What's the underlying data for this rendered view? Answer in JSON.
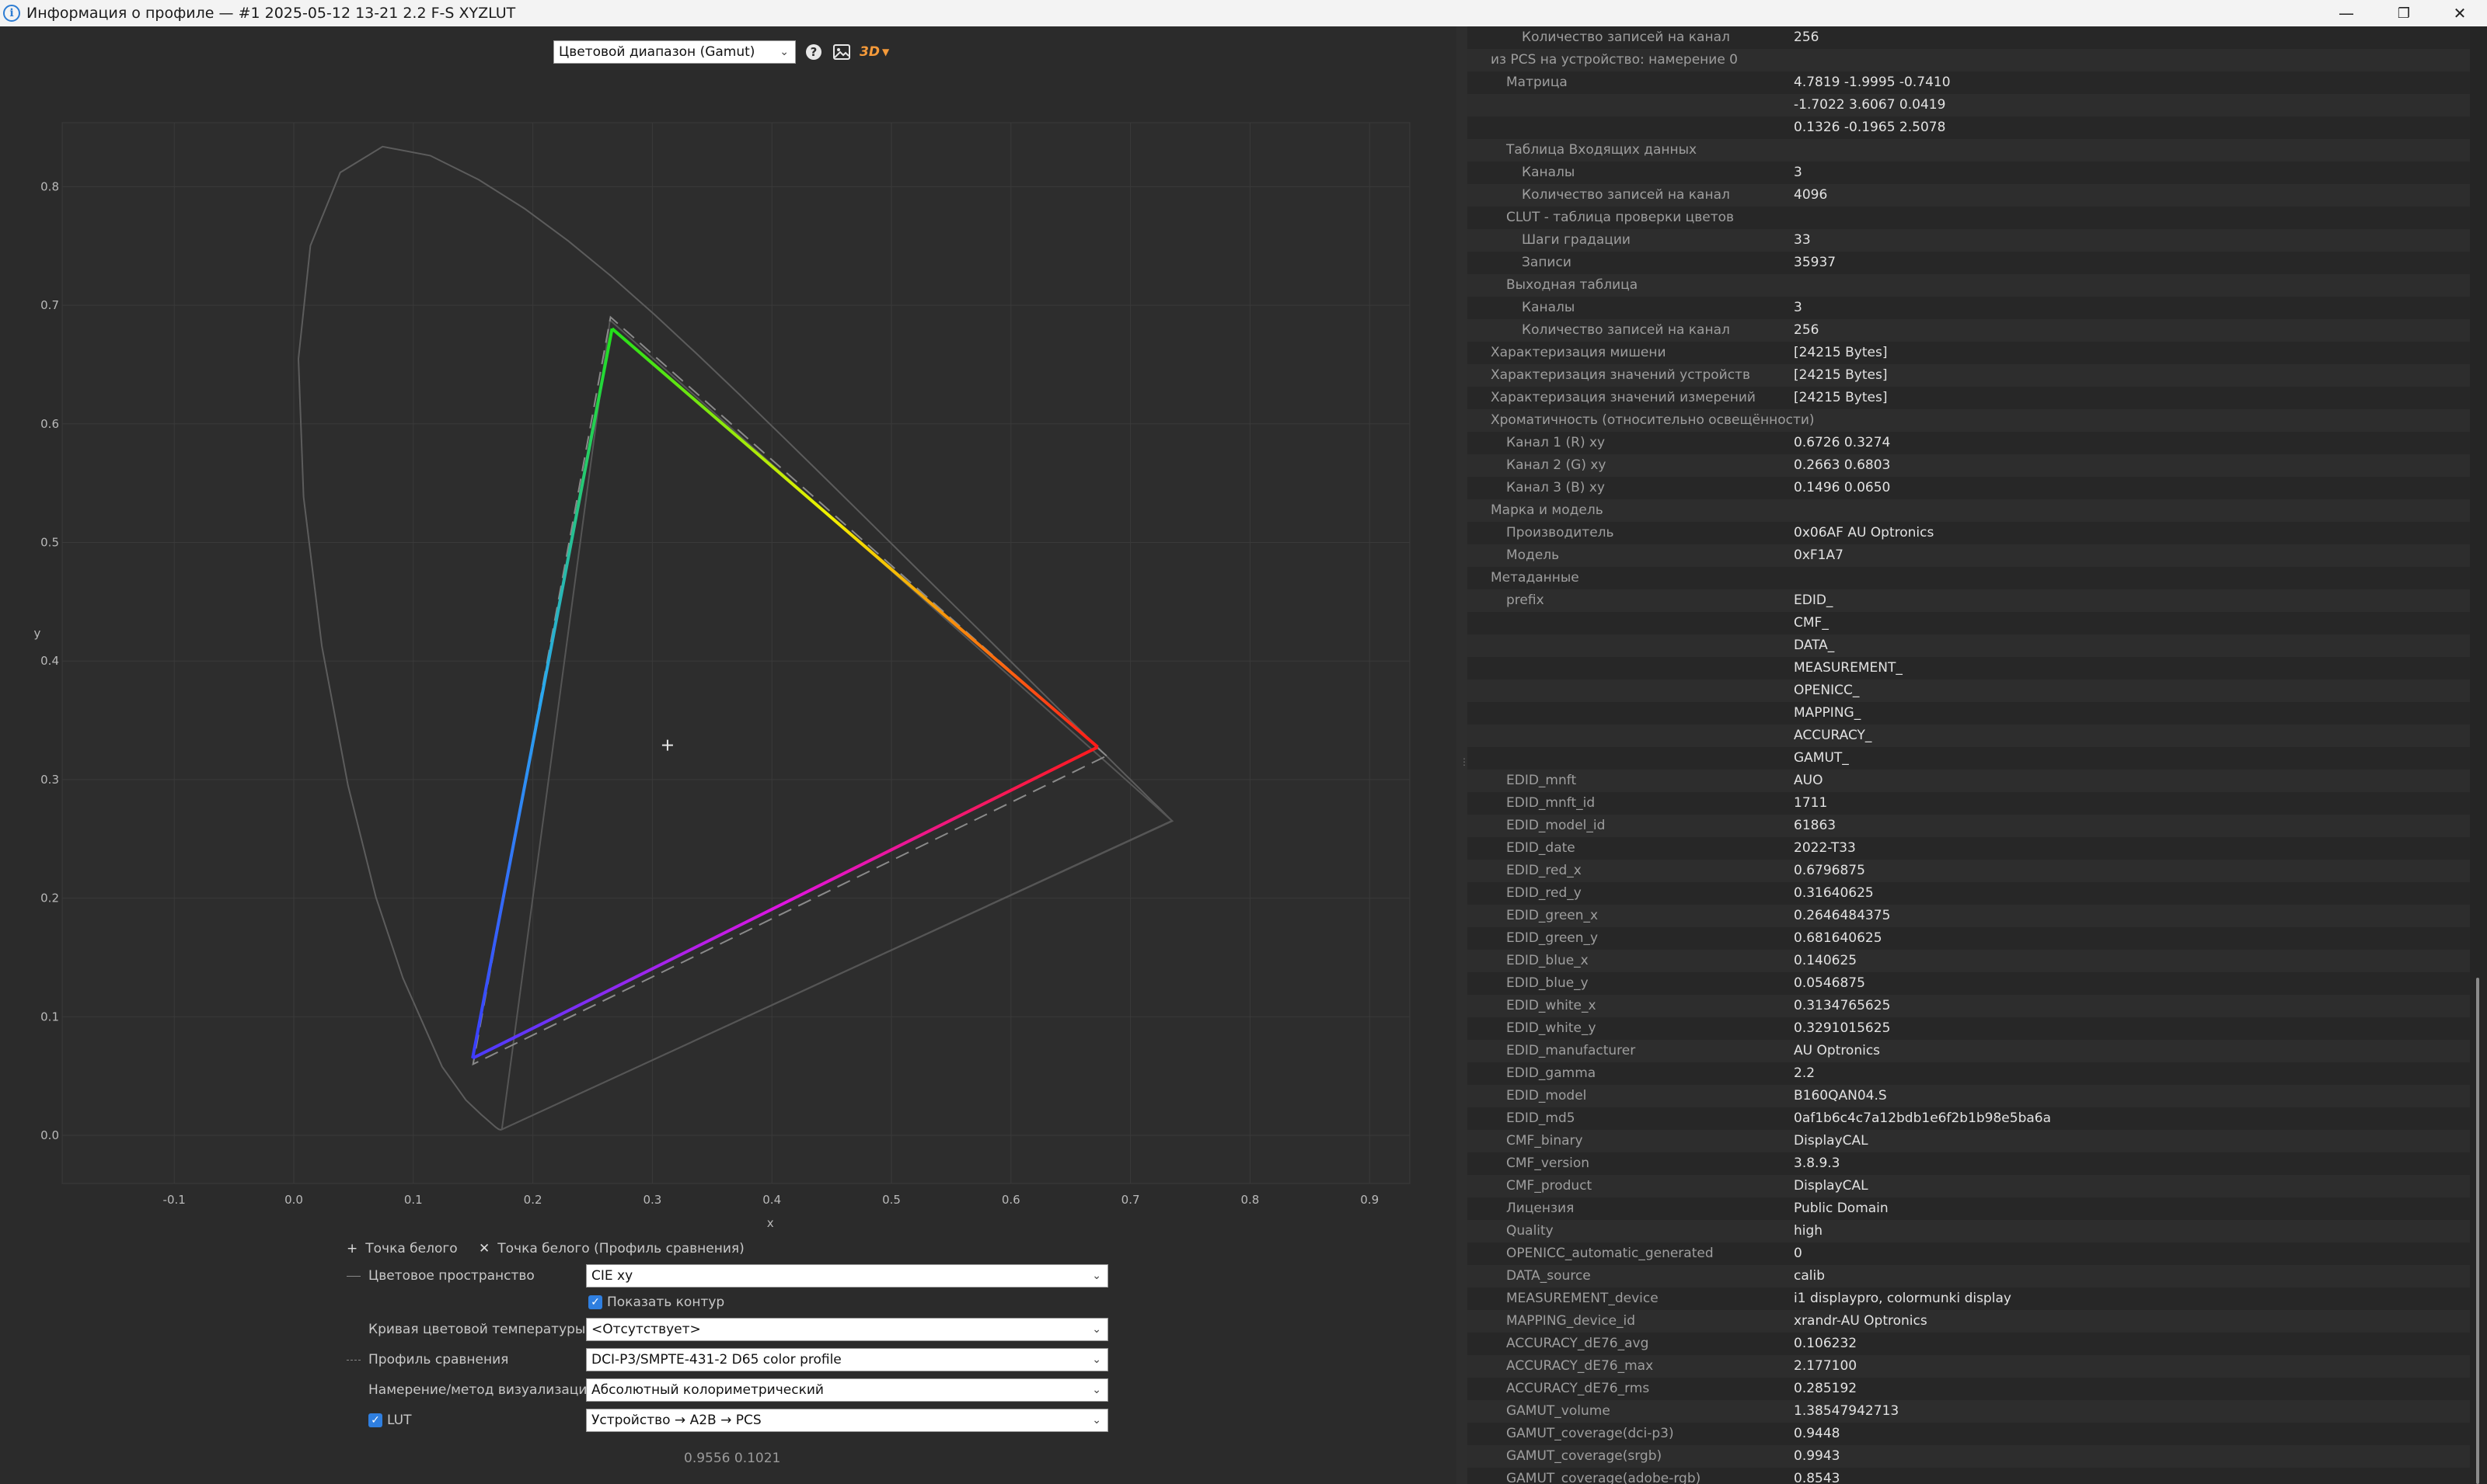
{
  "window": {
    "title": "Информация о профиле — #1 2025-05-12 13-21 2.2 F-S XYZLUT",
    "controls": {
      "minimize": "—",
      "maximize": "❐",
      "close": "✕"
    }
  },
  "toolbar": {
    "view_select": "Цветовой диапазон (Gamut)",
    "help_icon": "?",
    "image_icon": "▣",
    "view3d_label": "3D"
  },
  "plot": {
    "x_ticks": [
      "-0.1",
      "0.0",
      "0.1",
      "0.2",
      "0.3",
      "0.4",
      "0.5",
      "0.6",
      "0.7",
      "0.8",
      "0.9"
    ],
    "y_ticks": [
      "0.0",
      "0.1",
      "0.2",
      "0.3",
      "0.4",
      "0.5",
      "0.6",
      "0.7",
      "0.8"
    ],
    "xlabel": "x",
    "ylabel": "y",
    "gamut_primaries": {
      "red": [
        0.6726,
        0.3274
      ],
      "green": [
        0.2663,
        0.6803
      ],
      "blue": [
        0.1496,
        0.065
      ]
    },
    "reference_primaries": {
      "red": [
        0.68,
        0.32
      ],
      "green": [
        0.265,
        0.69
      ],
      "blue": [
        0.15,
        0.06
      ]
    },
    "outer_triangle": [
      [
        0.735,
        0.265
      ],
      [
        0.1741,
        0.005
      ],
      [
        0.2645,
        0.6875
      ]
    ],
    "cursor_readout": "0.9556 0.1021"
  },
  "controls": {
    "white_point": "Точка белого",
    "white_point_ref": "Точка белого (Профиль сравнения)",
    "color_space_label": "Цветовое пространство",
    "color_space_value": "CIE xy",
    "show_outline": "Показать контур",
    "cct_label": "Кривая цветовой температуры",
    "cct_value": "<Отсутствует>",
    "compare_label": "Профиль сравнения",
    "compare_value": "DCI-P3/SMPTE-431-2 D65 color profile",
    "intent_label": "Намерение/метод визуализации",
    "intent_value": "Абсолютный колориметрический",
    "lut_label": "LUT",
    "lut_value": "Устройство → A2B → PCS"
  },
  "info_rows": [
    {
      "indent": 2,
      "key": "Количество записей на канал",
      "value": "256"
    },
    {
      "indent": 0,
      "key": "из PCS на устройство: намерение 0",
      "value": ""
    },
    {
      "indent": 1,
      "key": "Матрица",
      "value": "4.7819 -1.9995 -0.7410"
    },
    {
      "indent": 1,
      "key": "",
      "value": "-1.7022 3.6067 0.0419"
    },
    {
      "indent": 1,
      "key": "",
      "value": "0.1326 -0.1965 2.5078"
    },
    {
      "indent": 1,
      "key": "Таблица Входящих данных",
      "value": ""
    },
    {
      "indent": 2,
      "key": "Каналы",
      "value": "3"
    },
    {
      "indent": 2,
      "key": "Количество записей на канал",
      "value": "4096"
    },
    {
      "indent": 1,
      "key": "CLUT - таблица проверки цветов",
      "value": ""
    },
    {
      "indent": 2,
      "key": "Шаги градации",
      "value": "33"
    },
    {
      "indent": 2,
      "key": "Записи",
      "value": "35937"
    },
    {
      "indent": 1,
      "key": "Выходная таблица",
      "value": ""
    },
    {
      "indent": 2,
      "key": "Каналы",
      "value": "3"
    },
    {
      "indent": 2,
      "key": "Количество записей на канал",
      "value": "256"
    },
    {
      "indent": 0,
      "key": "Характеризация мишени",
      "value": "[24215 Bytes]"
    },
    {
      "indent": 0,
      "key": "Характеризация значений устройств",
      "value": "[24215 Bytes]"
    },
    {
      "indent": 0,
      "key": "Характеризация значений измерений",
      "value": "[24215 Bytes]"
    },
    {
      "indent": 0,
      "key": "Хроматичность (относительно освещённости)",
      "value": ""
    },
    {
      "indent": 1,
      "key": "Канал 1 (R) xy",
      "value": "0.6726 0.3274"
    },
    {
      "indent": 1,
      "key": "Канал 2 (G) xy",
      "value": "0.2663 0.6803"
    },
    {
      "indent": 1,
      "key": "Канал 3 (B) xy",
      "value": "0.1496 0.0650"
    },
    {
      "indent": 0,
      "key": "Марка и модель",
      "value": ""
    },
    {
      "indent": 1,
      "key": "Производитель",
      "value": "0x06AF AU Optronics"
    },
    {
      "indent": 1,
      "key": "Модель",
      "value": "0xF1A7"
    },
    {
      "indent": 0,
      "key": "Метаданные",
      "value": ""
    },
    {
      "indent": 1,
      "key": "prefix",
      "value": "EDID_"
    },
    {
      "indent": 1,
      "key": "",
      "value": "CMF_"
    },
    {
      "indent": 1,
      "key": "",
      "value": "DATA_"
    },
    {
      "indent": 1,
      "key": "",
      "value": "MEASUREMENT_"
    },
    {
      "indent": 1,
      "key": "",
      "value": "OPENICC_"
    },
    {
      "indent": 1,
      "key": "",
      "value": "MAPPING_"
    },
    {
      "indent": 1,
      "key": "",
      "value": "ACCURACY_"
    },
    {
      "indent": 1,
      "key": "",
      "value": "GAMUT_"
    },
    {
      "indent": 1,
      "key": "EDID_mnft",
      "value": "AUO"
    },
    {
      "indent": 1,
      "key": "EDID_mnft_id",
      "value": "1711"
    },
    {
      "indent": 1,
      "key": "EDID_model_id",
      "value": "61863"
    },
    {
      "indent": 1,
      "key": "EDID_date",
      "value": "2022-T33"
    },
    {
      "indent": 1,
      "key": "EDID_red_x",
      "value": "0.6796875"
    },
    {
      "indent": 1,
      "key": "EDID_red_y",
      "value": "0.31640625"
    },
    {
      "indent": 1,
      "key": "EDID_green_x",
      "value": "0.2646484375"
    },
    {
      "indent": 1,
      "key": "EDID_green_y",
      "value": "0.681640625"
    },
    {
      "indent": 1,
      "key": "EDID_blue_x",
      "value": "0.140625"
    },
    {
      "indent": 1,
      "key": "EDID_blue_y",
      "value": "0.0546875"
    },
    {
      "indent": 1,
      "key": "EDID_white_x",
      "value": "0.3134765625"
    },
    {
      "indent": 1,
      "key": "EDID_white_y",
      "value": "0.3291015625"
    },
    {
      "indent": 1,
      "key": "EDID_manufacturer",
      "value": "AU Optronics"
    },
    {
      "indent": 1,
      "key": "EDID_gamma",
      "value": "2.2"
    },
    {
      "indent": 1,
      "key": "EDID_model",
      "value": "B160QAN04.S"
    },
    {
      "indent": 1,
      "key": "EDID_md5",
      "value": "0af1b6c4c7a12bdb1e6f2b1b98e5ba6a"
    },
    {
      "indent": 1,
      "key": "CMF_binary",
      "value": "DisplayCAL"
    },
    {
      "indent": 1,
      "key": "CMF_version",
      "value": "3.8.9.3"
    },
    {
      "indent": 1,
      "key": "CMF_product",
      "value": "DisplayCAL"
    },
    {
      "indent": 1,
      "key": "Лицензия",
      "value": "Public Domain"
    },
    {
      "indent": 1,
      "key": "Quality",
      "value": "high"
    },
    {
      "indent": 1,
      "key": "OPENICC_automatic_generated",
      "value": "0"
    },
    {
      "indent": 1,
      "key": "DATA_source",
      "value": "calib"
    },
    {
      "indent": 1,
      "key": "MEASUREMENT_device",
      "value": "i1 displaypro, colormunki display"
    },
    {
      "indent": 1,
      "key": "MAPPING_device_id",
      "value": "xrandr-AU Optronics"
    },
    {
      "indent": 1,
      "key": "ACCURACY_dE76_avg",
      "value": "0.106232"
    },
    {
      "indent": 1,
      "key": "ACCURACY_dE76_max",
      "value": "2.177100"
    },
    {
      "indent": 1,
      "key": "ACCURACY_dE76_rms",
      "value": "0.285192"
    },
    {
      "indent": 1,
      "key": "GAMUT_volume",
      "value": "1.38547942713"
    },
    {
      "indent": 1,
      "key": "GAMUT_coverage(dci-p3)",
      "value": "0.9448"
    },
    {
      "indent": 1,
      "key": "GAMUT_coverage(srgb)",
      "value": "0.9943"
    },
    {
      "indent": 1,
      "key": "GAMUT_coverage(adobe-rgb)",
      "value": "0.8543"
    }
  ]
}
